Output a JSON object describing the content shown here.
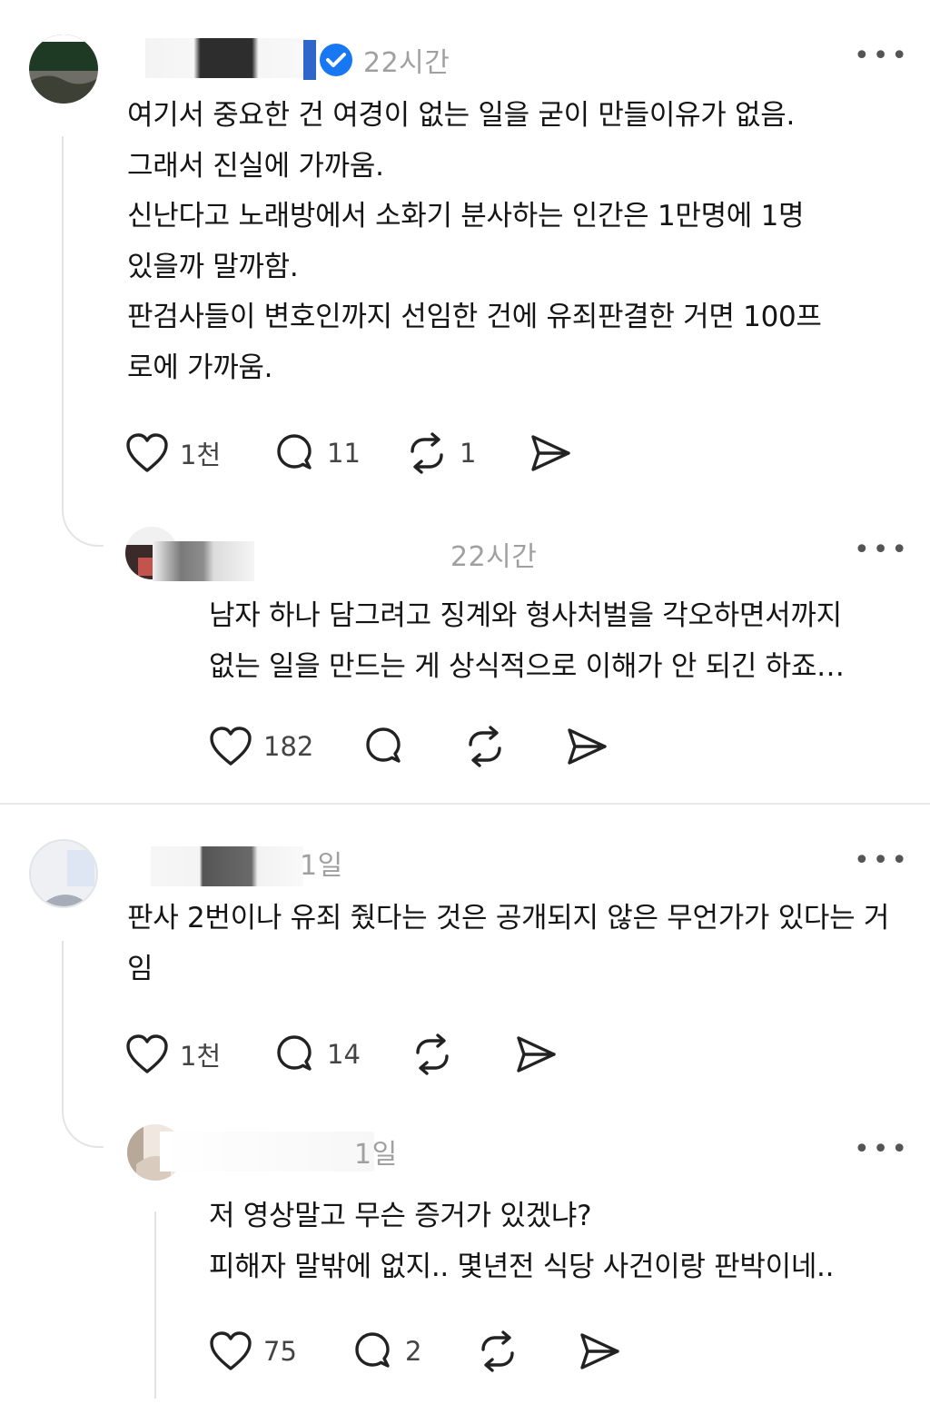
{
  "icons": {
    "like": "heart-icon",
    "reply": "speech-bubble-icon",
    "repost": "repost-arrows-icon",
    "share": "paper-plane-icon",
    "verified": "verified-badge-icon",
    "more": "more-dots-icon"
  },
  "colors": {
    "verified_badge": "#1877f2",
    "text": "#141414",
    "muted": "#a0a0a0",
    "icon": "#222222"
  },
  "posts": [
    {
      "time": "22시간",
      "more": "•••",
      "body": "여기서 중요한 건 여경이 없는 일을 굳이 만들이유가 없음.\n그래서 진실에 가까움.\n신난다고 노래방에서 소화기 분사하는 인간은 1만명에 1명 있을까 말까함.\n판검사들이 변호인까지 선임한 건에 유죄판결한 거면 100프로에 가까움.",
      "likes": "1천",
      "replies": "11",
      "reposts": "1"
    },
    {
      "time": "22시간",
      "more": "•••",
      "body": "남자 하나 담그려고 징계와 형사처벌을 각오하면서까지\n없는 일을 만드는 게 상식적으로 이해가 안 되긴 하죠…",
      "likes": "182",
      "replies": "",
      "reposts": ""
    },
    {
      "time": "1일",
      "more": "•••",
      "body": "판사 2번이나 유죄 줬다는 것은 공개되지 않은 무언가가 있다는 거임",
      "likes": "1천",
      "replies": "14",
      "reposts": ""
    },
    {
      "time": "1일",
      "more": "•••",
      "body": "저 영상말고 무슨 증거가 있겠냐?\n피해자 말밖에 없지.. 몇년전 식당 사건이랑 판박이네..",
      "likes": "75",
      "replies": "2",
      "reposts": ""
    }
  ]
}
